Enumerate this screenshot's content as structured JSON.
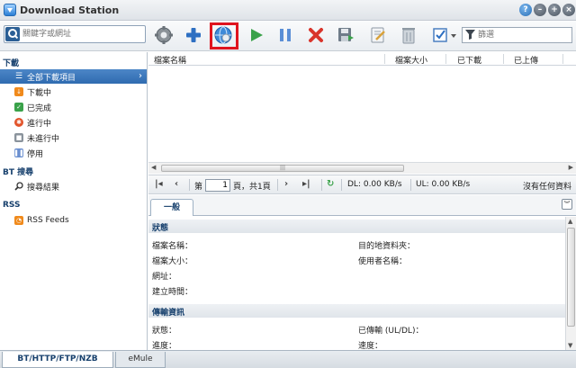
{
  "window": {
    "title": "Download Station"
  },
  "toolbar": {
    "search_placeholder": "關鍵字或網址",
    "filter_placeholder": "篩選"
  },
  "sidebar": {
    "download_header": "下載",
    "items": [
      {
        "label": "全部下載項目",
        "active": true,
        "icon": "list-icon"
      },
      {
        "label": "下載中",
        "icon": "download-arrow-icon"
      },
      {
        "label": "已完成",
        "icon": "check-icon"
      },
      {
        "label": "進行中",
        "icon": "active-icon"
      },
      {
        "label": "未進行中",
        "icon": "inactive-icon"
      },
      {
        "label": "停用",
        "icon": "pause-icon"
      }
    ],
    "bt_header": "BT 搜尋",
    "bt_item": "搜尋結果",
    "rss_header": "RSS",
    "rss_item": "RSS Feeds"
  },
  "list": {
    "columns": [
      "檔案名稱",
      "檔案大小",
      "已下載",
      "已上傳"
    ]
  },
  "pager": {
    "page_prefix": "第",
    "page_value": "1",
    "page_suffix": "頁，共1頁",
    "dl_speed": "DL: 0.00 KB/s",
    "ul_speed": "UL: 0.00 KB/s",
    "empty_text": "沒有任何資料"
  },
  "detail": {
    "tab_general": "一般",
    "status_section": "狀態",
    "filename_label": "檔案名稱：",
    "destination_label": "目的地資料夾：",
    "filesize_label": "檔案大小：",
    "username_label": "使用者名稱：",
    "url_label": "網址：",
    "created_label": "建立時間：",
    "transfer_section": "傳輸資訊",
    "state_label": "狀態：",
    "transferred_label": "已傳輸 (UL/DL)：",
    "progress_label": "進度：",
    "speed_label": "速度："
  },
  "bottom_tabs": {
    "tab1": "BT/HTTP/FTP/NZB",
    "tab2": "eMule"
  },
  "colors": {
    "accent": "#2f6bb0",
    "highlight": "#e0141e",
    "play": "#3aa24a",
    "pause": "#5b8fd6",
    "delete": "#d9342b"
  }
}
